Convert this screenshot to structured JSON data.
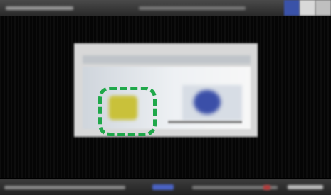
{
  "window": {
    "title": "",
    "control_icons": [
      "minimize-icon",
      "maximize-icon",
      "close-icon"
    ]
  },
  "dialog": {
    "items": [
      {
        "name": "yellow-thumbnail",
        "color": "#c9c13a",
        "selected": true
      },
      {
        "name": "blue-thumbnail",
        "color": "#3b4fa8",
        "selected": false
      }
    ],
    "selection_color": "#1fa84a"
  },
  "taskbar": {
    "accent_color": "#4a63c4",
    "alert_color": "#b23b3b"
  }
}
